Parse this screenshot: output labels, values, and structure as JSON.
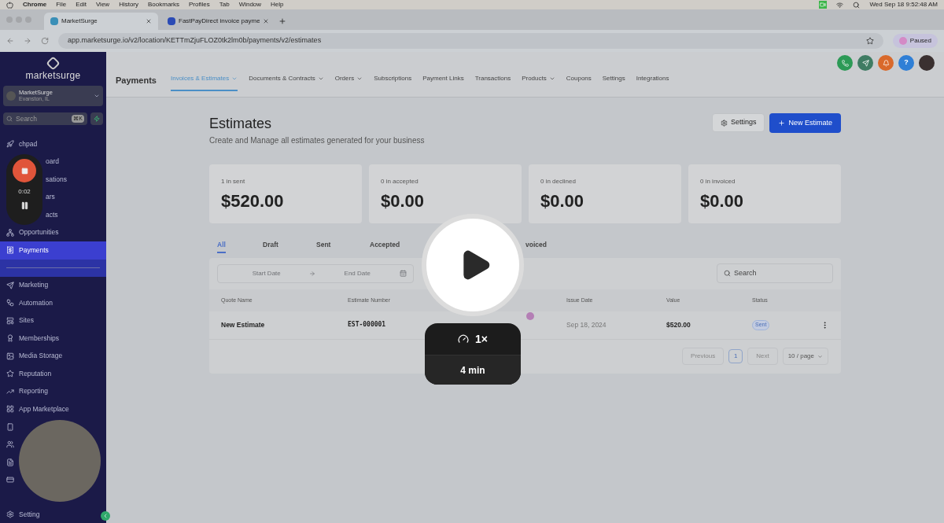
{
  "menu_bar": {
    "app": "Chrome",
    "items": [
      "File",
      "Edit",
      "View",
      "History",
      "Bookmarks",
      "Profiles",
      "Tab",
      "Window",
      "Help"
    ],
    "clock": "Wed Sep 18  9:52:48 AM"
  },
  "browser": {
    "tabs": [
      {
        "label": "MarketSurge",
        "selected": true
      },
      {
        "label": "FastPayDirect invoice payme",
        "selected": false
      }
    ],
    "url": "app.marketsurge.io/v2/location/KETTmZjuFLOZ0tk2lm0b/payments/v2/estimates",
    "profile": "Paused"
  },
  "sidebar": {
    "logo": "marketsurge",
    "account": {
      "name": "MarketSurge",
      "location": "Evanston, IL"
    },
    "search": {
      "placeholder": "Search",
      "shortcut": "⌘K"
    },
    "items": [
      {
        "kind": "rocket",
        "label": "chpad",
        "selected": false
      },
      {
        "kind": "covered",
        "label": "oard",
        "selected": false
      },
      {
        "kind": "covered",
        "label": "sations",
        "selected": false
      },
      {
        "kind": "covered",
        "label": "ars",
        "selected": false
      },
      {
        "kind": "covered",
        "label": "acts",
        "selected": false
      },
      {
        "kind": "network",
        "label": "Opportunities",
        "selected": false
      },
      {
        "kind": "receipt",
        "label": "Payments",
        "selected": true
      },
      {
        "kind": "divider"
      },
      {
        "kind": "send",
        "label": "Marketing",
        "selected": false
      },
      {
        "kind": "automation",
        "label": "Automation",
        "selected": false
      },
      {
        "kind": "site",
        "label": "Sites",
        "selected": false
      },
      {
        "kind": "award",
        "label": "Memberships",
        "selected": false
      },
      {
        "kind": "image",
        "label": "Media Storage",
        "selected": false
      },
      {
        "kind": "star",
        "label": "Reputation",
        "selected": false
      },
      {
        "kind": "trend",
        "label": "Reporting",
        "selected": false
      },
      {
        "kind": "grid",
        "label": "App Marketplace",
        "selected": false
      },
      {
        "kind": "phone",
        "selected": false
      },
      {
        "kind": "users",
        "selected": false
      },
      {
        "kind": "doc",
        "selected": false
      },
      {
        "kind": "card",
        "selected": false
      }
    ],
    "settings": "Setting"
  },
  "top_nav": {
    "title": "Payments",
    "tabs": [
      {
        "label": "Invoices & Estimates",
        "dropdown": true,
        "selected": true
      },
      {
        "label": "Documents & Contracts",
        "dropdown": true,
        "selected": false
      },
      {
        "label": "Orders",
        "dropdown": true,
        "selected": false
      },
      {
        "label": "Subscriptions",
        "dropdown": false,
        "selected": false
      },
      {
        "label": "Payment Links",
        "dropdown": false,
        "selected": false
      },
      {
        "label": "Transactions",
        "dropdown": false,
        "selected": false
      },
      {
        "label": "Products",
        "dropdown": true,
        "selected": false
      },
      {
        "label": "Coupons",
        "dropdown": false,
        "selected": false
      },
      {
        "label": "Settings",
        "dropdown": false,
        "selected": false
      },
      {
        "label": "Integrations",
        "dropdown": false,
        "selected": false
      }
    ],
    "help": "?"
  },
  "page": {
    "title": "Estimates",
    "subtitle": "Create and Manage all estimates generated for your business",
    "settings_button": "Settings",
    "new_button": "New Estimate",
    "stats": [
      {
        "label": "1 in sent",
        "value": "$520.00"
      },
      {
        "label": "0 in accepted",
        "value": "$0.00"
      },
      {
        "label": "0 in declined",
        "value": "$0.00"
      },
      {
        "label": "0 in invoiced",
        "value": "$0.00"
      }
    ],
    "filter_tabs": [
      {
        "label": "All",
        "selected": true
      },
      {
        "label": "Draft",
        "selected": false
      },
      {
        "label": "Sent",
        "selected": false
      },
      {
        "label": "Accepted",
        "selected": false
      },
      {
        "label": "voiced",
        "selected": false
      }
    ],
    "date_range": {
      "start_placeholder": "Start Date",
      "end_placeholder": "End Date"
    },
    "search": {
      "placeholder": "Search"
    },
    "table": {
      "columns": [
        "Quote Name",
        "Estimate Number",
        "Issue Date",
        "Value",
        "Status"
      ],
      "rows": [
        {
          "quote_name": "New Estimate",
          "estimate_number": "EST-000001",
          "issue_date": "Sep 18, 2024",
          "value": "$520.00",
          "status": "Sent"
        }
      ]
    },
    "pagination": {
      "previous": "Previous",
      "page": "1",
      "next": "Next",
      "page_size": "10 / page"
    }
  },
  "player": {
    "speed": "1×",
    "duration": "4 min",
    "recorder_time": "0:02"
  }
}
